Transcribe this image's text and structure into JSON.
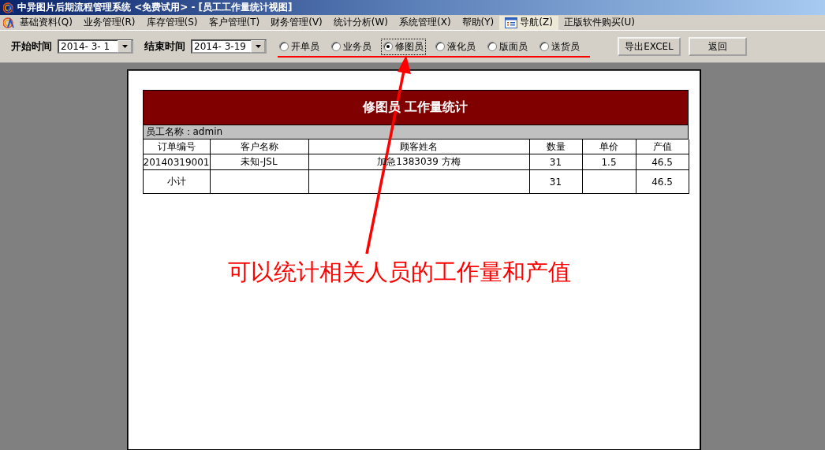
{
  "window": {
    "title": "中异图片后期流程管理系统 <免费试用> - [员工工作量统计视图]"
  },
  "menu": [
    {
      "label": "基础资料(Q)",
      "highlighted": false,
      "kind": "plain"
    },
    {
      "label": "业务管理(R)",
      "highlighted": false,
      "kind": "plain"
    },
    {
      "label": "库存管理(S)",
      "highlighted": false,
      "kind": "plain"
    },
    {
      "label": "客户管理(T)",
      "highlighted": false,
      "kind": "plain"
    },
    {
      "label": "财务管理(V)",
      "highlighted": false,
      "kind": "plain"
    },
    {
      "label": "统计分析(W)",
      "highlighted": false,
      "kind": "plain"
    },
    {
      "label": "系统管理(X)",
      "highlighted": false,
      "kind": "plain"
    },
    {
      "label": "帮助(Y)",
      "highlighted": false,
      "kind": "plain"
    },
    {
      "label": "导航(Z)",
      "highlighted": true,
      "kind": "icon"
    },
    {
      "label": "正版软件购买(U)",
      "highlighted": false,
      "kind": "plain"
    }
  ],
  "filters": [
    {
      "label": "开始时间",
      "value": "2014- 3- 1"
    },
    {
      "label": "结束时间",
      "value": "2014- 3-19"
    }
  ],
  "roles": [
    {
      "label": "开单员",
      "selected": false
    },
    {
      "label": "业务员",
      "selected": false
    },
    {
      "label": "修图员",
      "selected": true
    },
    {
      "label": "液化员",
      "selected": false
    },
    {
      "label": "版面员",
      "selected": false
    },
    {
      "label": "送货员",
      "selected": false
    }
  ],
  "buttons": [
    "导出EXCEL",
    "返回"
  ],
  "report": {
    "title": "修图员 工作量统计",
    "employee": "员工名称：admin",
    "columns": [
      "订单编号",
      "客户名称",
      "顾客姓名",
      "数量",
      "单价",
      "产值"
    ],
    "rows": [
      [
        "20140319001",
        "未知-JSL",
        "加急1383039 方梅",
        "31",
        "1.5",
        "46.5"
      ]
    ],
    "subtotal": {
      "label": "小计",
      "quantity": "31",
      "value": "46.5"
    }
  },
  "annotation": "可以统计相关人员的工作量和产值"
}
